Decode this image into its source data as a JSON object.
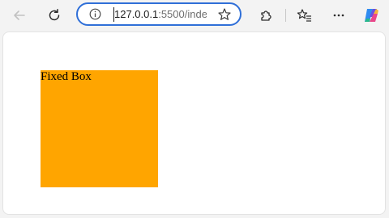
{
  "browser": {
    "address": {
      "host": "127.0.0.1",
      "rest": ":5500/inde"
    },
    "buttons": {
      "back": "back-icon",
      "refresh": "refresh-icon",
      "site_info": "info-icon",
      "favorite": "star-icon",
      "extensions": "puzzle-icon",
      "favorites_list": "favorites-icon",
      "more": "more-icon",
      "copilot": "copilot-icon"
    }
  },
  "page": {
    "box_label": "Fixed Box",
    "box_color": "#ffa500"
  }
}
